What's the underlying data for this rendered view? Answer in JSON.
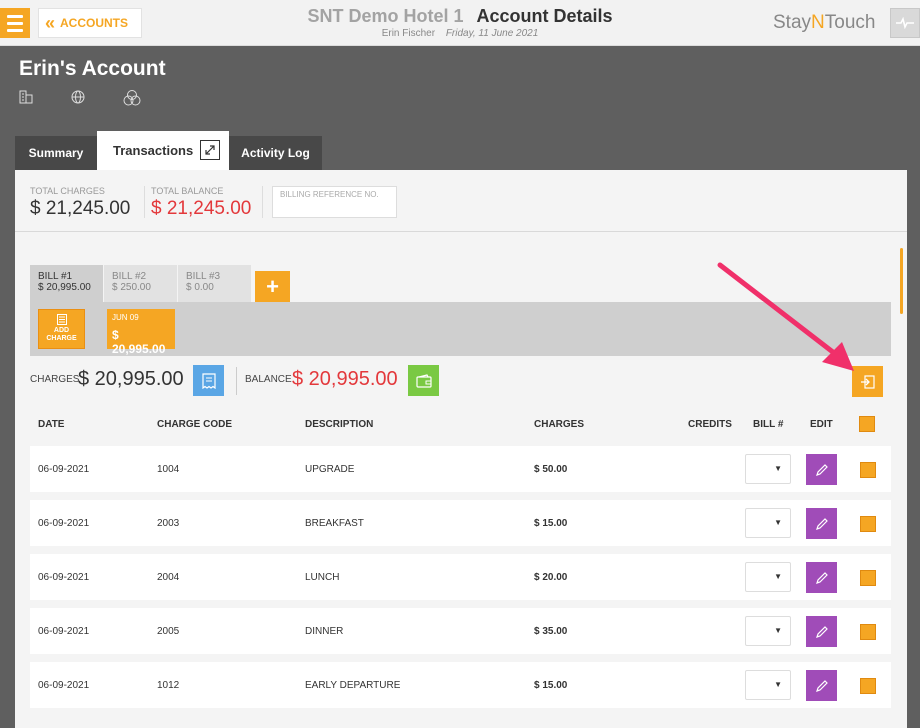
{
  "header": {
    "back_label": "ACCOUNTS",
    "hotel_name": "SNT Demo Hotel 1",
    "page_title": "Account Details",
    "user": "Erin Fischer",
    "date": "Friday, 11 June 2021",
    "brand_pre": "Stay",
    "brand_n": "N",
    "brand_post": "Touch"
  },
  "account": {
    "name": "Erin's Account",
    "icons": [
      "building-icon",
      "globe-icon",
      "circles-icon"
    ]
  },
  "tabs": [
    {
      "label": "Summary",
      "active": false
    },
    {
      "label": "Transactions",
      "active": true
    },
    {
      "label": "Activity Log",
      "active": false
    }
  ],
  "totals": {
    "charges_label": "TOTAL CHARGES",
    "charges_value": "$ 21,245.00",
    "balance_label": "TOTAL BALANCE",
    "balance_value": "$ 21,245.00",
    "billing_ref_placeholder": "BILLING REFERENCE NO."
  },
  "bills": [
    {
      "label": "BILL #1",
      "amount": "$ 20,995.00",
      "active": true
    },
    {
      "label": "BILL #2",
      "amount": "$ 250.00",
      "active": false
    },
    {
      "label": "BILL #3",
      "amount": "$ 0.00",
      "active": false
    }
  ],
  "add_bill_label": "+",
  "add_charge": {
    "line1": "ADD",
    "line2": "CHARGE"
  },
  "date_card": {
    "date": "JUN 09",
    "amount": "$ 20,995.00"
  },
  "summary": {
    "charges_label": "CHARGES",
    "charges_value": "$ 20,995.00",
    "balance_label": "BALANCE",
    "balance_value": "$ 20,995.00"
  },
  "table": {
    "headers": {
      "date": "DATE",
      "code": "CHARGE CODE",
      "desc": "DESCRIPTION",
      "charges": "CHARGES",
      "credits": "CREDITS",
      "bill": "BILL #",
      "edit": "EDIT"
    },
    "rows": [
      {
        "date": "06-09-2021",
        "code": "1004",
        "desc": "UPGRADE",
        "charges": "$ 50.00"
      },
      {
        "date": "06-09-2021",
        "code": "2003",
        "desc": "BREAKFAST",
        "charges": "$ 15.00"
      },
      {
        "date": "06-09-2021",
        "code": "2004",
        "desc": "LUNCH",
        "charges": "$ 20.00"
      },
      {
        "date": "06-09-2021",
        "code": "2005",
        "desc": "DINNER",
        "charges": "$ 35.00"
      },
      {
        "date": "06-09-2021",
        "code": "1012",
        "desc": "EARLY DEPARTURE",
        "charges": "$ 15.00"
      }
    ],
    "select_arrow": "▼"
  },
  "colors": {
    "accent": "#f5a623",
    "negative": "#e3383b",
    "edit": "#a04cb8",
    "invoice": "#5aa6e5",
    "wallet": "#7ac943",
    "annotation_arrow": "#f0306a"
  }
}
